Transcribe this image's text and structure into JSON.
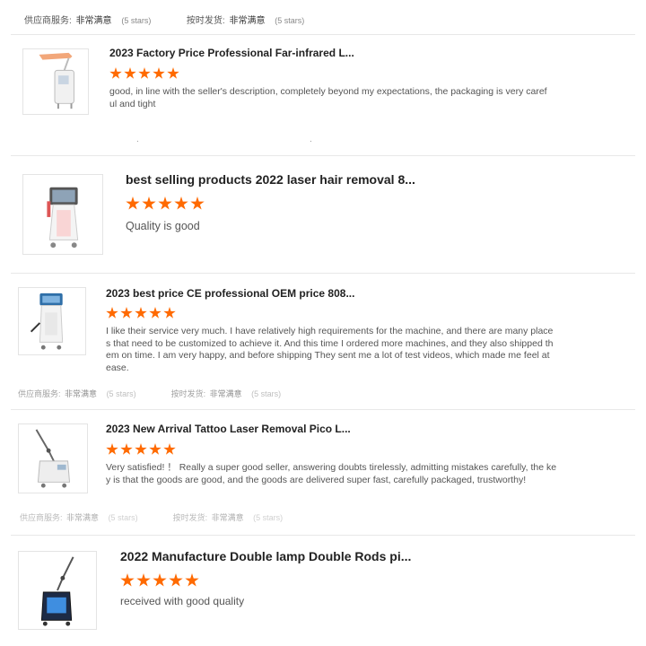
{
  "summary": {
    "supplier_label": "供应商服务:",
    "supplier_value": "非常满意",
    "supplier_note": "(5 stars)",
    "shipping_label": "按时发货:",
    "shipping_value": "非常满意",
    "shipping_note": "(5 stars)"
  },
  "colors": {
    "star": "#ff6a00",
    "divider": "#e8e8e8"
  },
  "reviews": [
    {
      "title": "2023 Factory Price Professional Far-infrared L...",
      "rating": 5,
      "text": "good, in line with the seller's description, completely beyond my expectations, the packaging is very careful and tight",
      "icon": "laser-machine-tall-arm-icon"
    },
    {
      "title": "best selling products 2022 laser hair removal 8...",
      "rating": 5,
      "text": "Quality is good",
      "icon": "laser-hair-removal-machine-icon"
    },
    {
      "title": "2023 best price CE professional OEM price 808...",
      "rating": 5,
      "text": "I like their service very much. I have relatively high requirements for the machine, and there are many places that need to be customized to achieve it. And this time I ordered more machines, and they also shipped them on time. I am very happy, and before shipping They sent me a lot of test videos, which made me feel at ease.",
      "icon": "diode-laser-machine-icon"
    },
    {
      "title": "2023 New Arrival Tattoo Laser Removal Pico L...",
      "rating": 5,
      "text": "Very satisfied! ！ Really a super good seller, answering doubts tirelessly, admitting mistakes carefully, the key is that the goods are good, and the goods are delivered super fast, carefully packaged, trustworthy!",
      "icon": "pico-laser-arm-icon"
    },
    {
      "title": "2022 Manufacture Double lamp Double Rods pi...",
      "rating": 5,
      "text": "received with good quality",
      "icon": "double-lamp-laser-icon"
    }
  ]
}
